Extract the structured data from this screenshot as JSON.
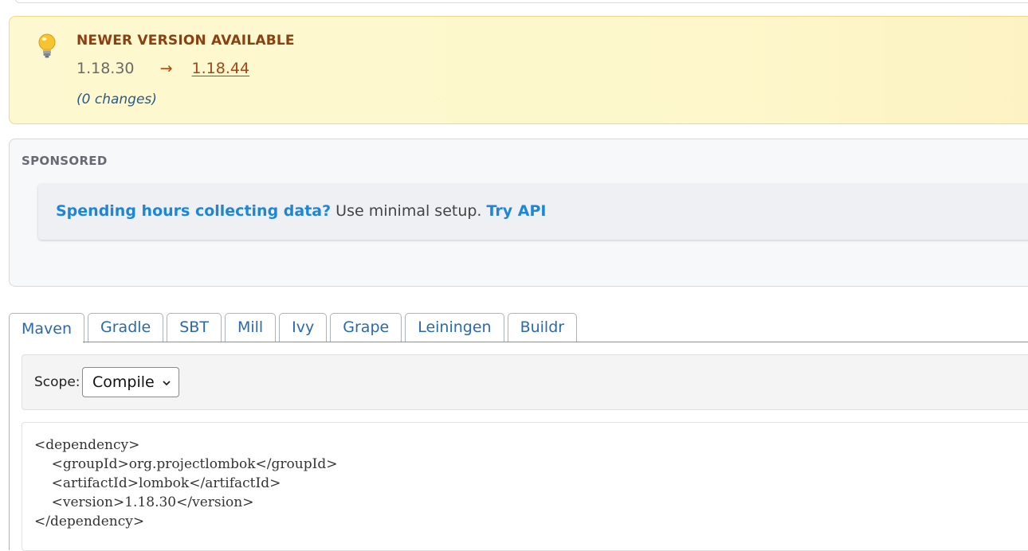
{
  "newer_version": {
    "title": "NEWER VERSION AVAILABLE",
    "current": "1.18.30",
    "arrow": "→",
    "latest": "1.18.44",
    "changes": "(0 changes)"
  },
  "sponsored": {
    "label": "SPONSORED",
    "ad_lead": "Spending hours collecting data?",
    "ad_body": " Use minimal setup. ",
    "ad_cta": "Try API"
  },
  "tabs": [
    {
      "label": "Maven",
      "active": true
    },
    {
      "label": "Gradle"
    },
    {
      "label": "SBT"
    },
    {
      "label": "Mill"
    },
    {
      "label": "Ivy"
    },
    {
      "label": "Grape"
    },
    {
      "label": "Leiningen"
    },
    {
      "label": "Buildr"
    }
  ],
  "scope": {
    "label": "Scope:",
    "selected": "Compile"
  },
  "code": {
    "lines": [
      "<dependency>",
      "    <groupId>org.projectlombok</groupId>",
      "    <artifactId>lombok</artifactId>",
      "    <version>1.18.30</version>",
      "</dependency>"
    ]
  },
  "colors": {
    "notice_bg": "#fdf8cf",
    "notice_title": "#8a4011",
    "link_blue": "#1e86d6",
    "tab_text": "#2a6aa8"
  }
}
